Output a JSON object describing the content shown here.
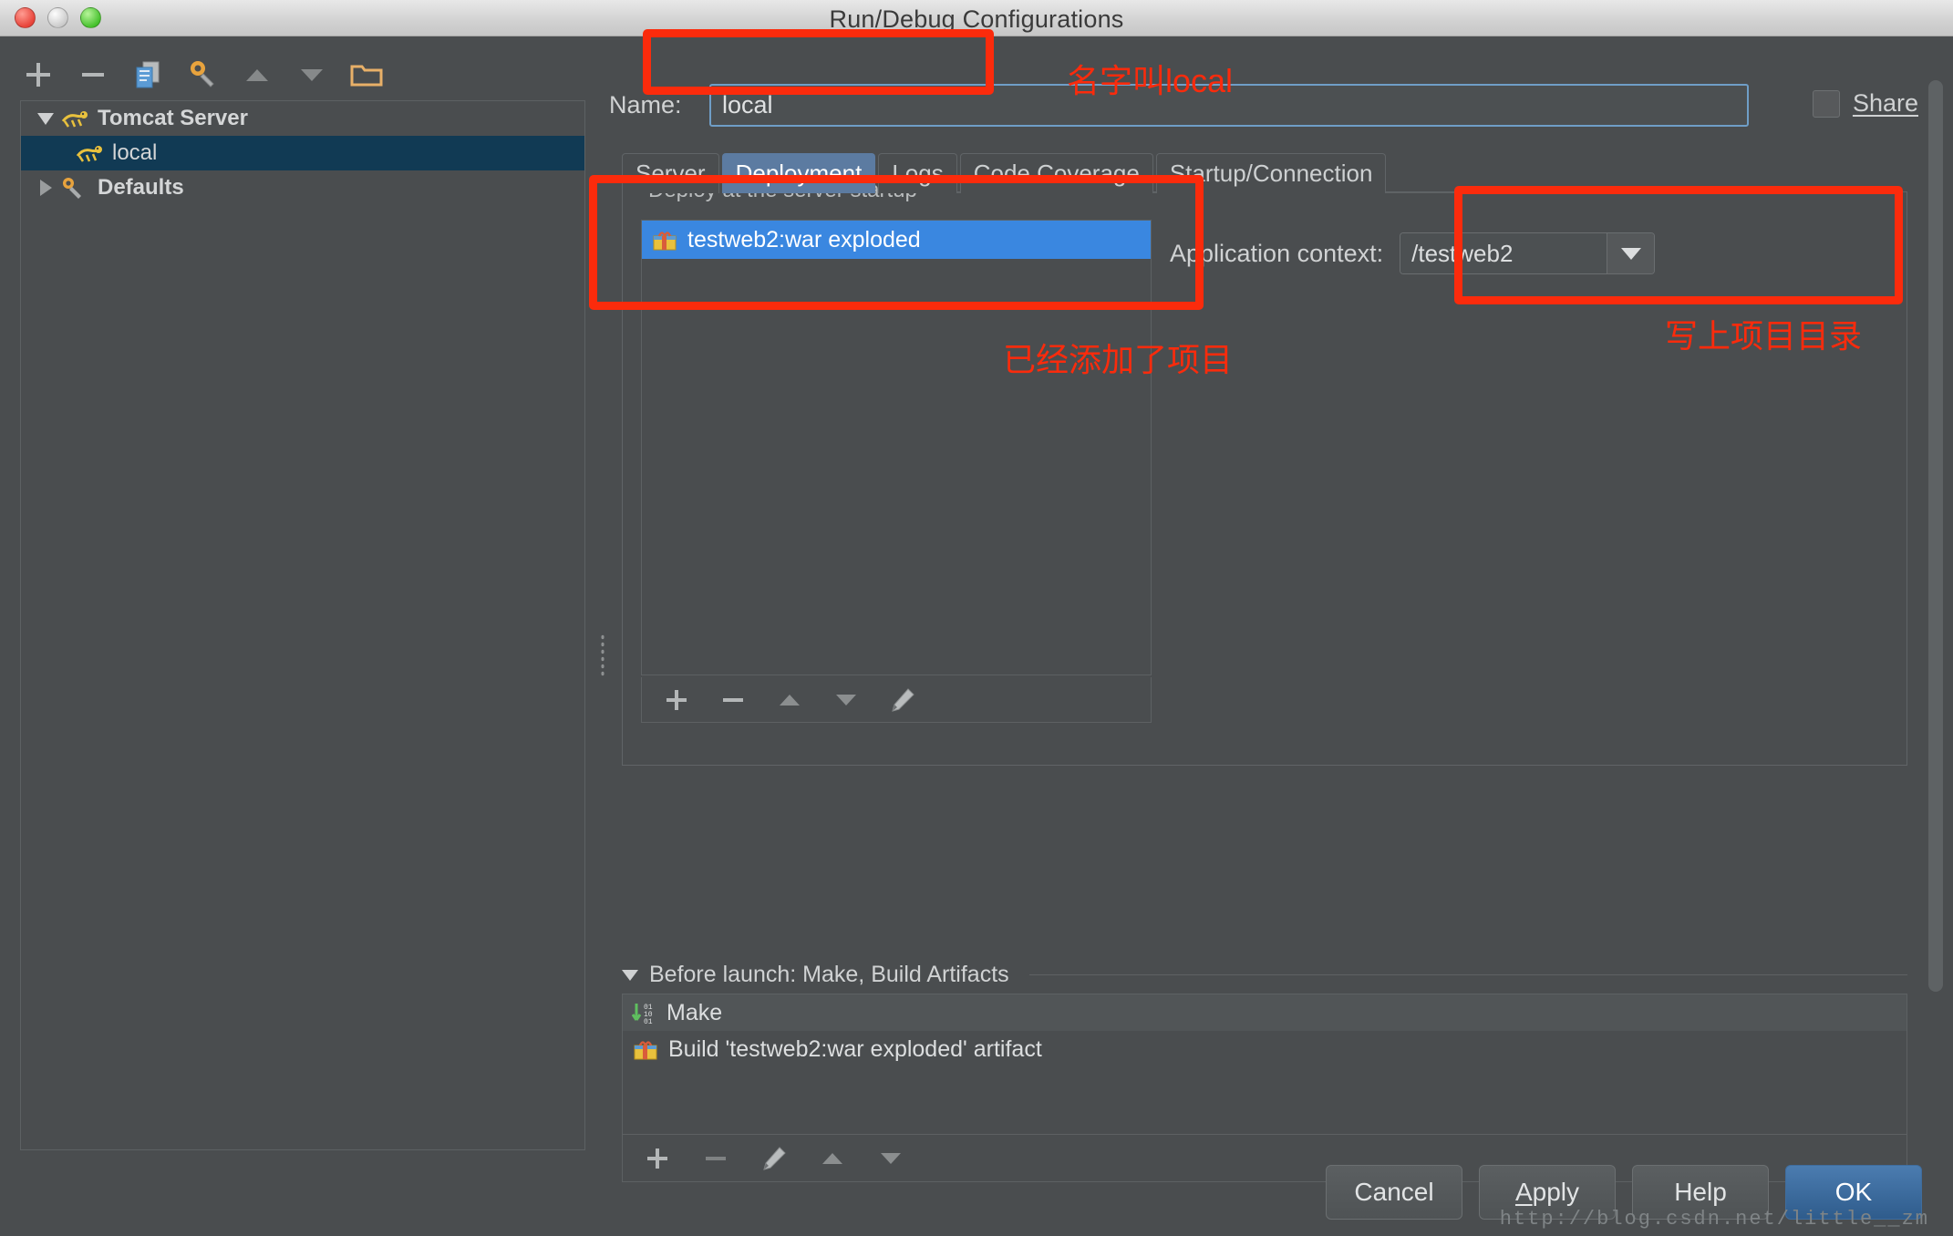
{
  "window": {
    "title": "Run/Debug Configurations",
    "lights": [
      "close-button",
      "minimize-button",
      "zoom-button"
    ]
  },
  "left_toolbar": {
    "items": [
      {
        "name": "add-configuration-button",
        "icon": "plus-icon"
      },
      {
        "name": "remove-configuration-button",
        "icon": "minus-icon"
      },
      {
        "name": "copy-configuration-button",
        "icon": "copy-icon"
      },
      {
        "name": "edit-defaults-button",
        "icon": "wrench-icon"
      },
      {
        "name": "move-up-button",
        "icon": "arrow-up-icon"
      },
      {
        "name": "move-down-button",
        "icon": "arrow-down-icon"
      },
      {
        "name": "create-folder-button",
        "icon": "folder-icon"
      }
    ]
  },
  "tree": {
    "nodes": [
      {
        "label": "Tomcat Server",
        "icon": "tomcat-icon",
        "expanded": true,
        "level": 0,
        "selected": false,
        "bold": true
      },
      {
        "label": "local",
        "icon": "tomcat-icon",
        "expanded": null,
        "level": 1,
        "selected": true,
        "bold": false
      },
      {
        "label": "Defaults",
        "icon": "wrench-icon",
        "expanded": false,
        "level": 0,
        "selected": false,
        "bold": true
      }
    ]
  },
  "name_field": {
    "label": "Name:",
    "value": "local",
    "placeholder": ""
  },
  "share": {
    "label": "Share",
    "checked": false
  },
  "tabs": [
    {
      "label": "Server",
      "active": false
    },
    {
      "label": "Deployment",
      "active": true
    },
    {
      "label": "Logs",
      "active": false
    },
    {
      "label": "Code Coverage",
      "active": false
    },
    {
      "label": "Startup/Connection",
      "active": false
    }
  ],
  "deployment": {
    "group_label": "Deploy at the server startup",
    "artifacts": [
      {
        "label": "testweb2:war exploded",
        "icon": "artifact-icon",
        "selected": true
      }
    ],
    "list_toolbar": [
      {
        "name": "add-artifact-button",
        "icon": "plus-icon"
      },
      {
        "name": "remove-artifact-button",
        "icon": "minus-icon"
      },
      {
        "name": "artifact-move-up-button",
        "icon": "arrow-up-icon"
      },
      {
        "name": "artifact-move-down-button",
        "icon": "arrow-down-icon"
      },
      {
        "name": "edit-artifact-button",
        "icon": "pencil-icon"
      }
    ],
    "application_context": {
      "label": "Application context:",
      "value": "/testweb2"
    }
  },
  "before_launch": {
    "title": "Before launch: Make, Build Artifacts",
    "tasks": [
      {
        "label": "Make",
        "icon": "compile-icon"
      },
      {
        "label": "Build 'testweb2:war exploded' artifact",
        "icon": "artifact-icon"
      }
    ],
    "toolbar": [
      {
        "name": "add-task-button",
        "icon": "plus-icon"
      },
      {
        "name": "remove-task-button",
        "icon": "minus-icon"
      },
      {
        "name": "edit-task-button",
        "icon": "pencil-icon"
      },
      {
        "name": "task-move-up-button",
        "icon": "arrow-up-icon"
      },
      {
        "name": "task-move-down-button",
        "icon": "arrow-down-icon"
      }
    ]
  },
  "buttons": {
    "cancel": "Cancel",
    "apply_prefix": "A",
    "apply_rest": "pply",
    "help": "Help",
    "ok": "OK"
  },
  "annotations": {
    "name_note": "名字叫local",
    "artifact_note": "已经添加了项目",
    "context_note": "写上项目目录",
    "color": "#fb2b0c"
  },
  "watermark": "http://blog.csdn.net/little__zm"
}
